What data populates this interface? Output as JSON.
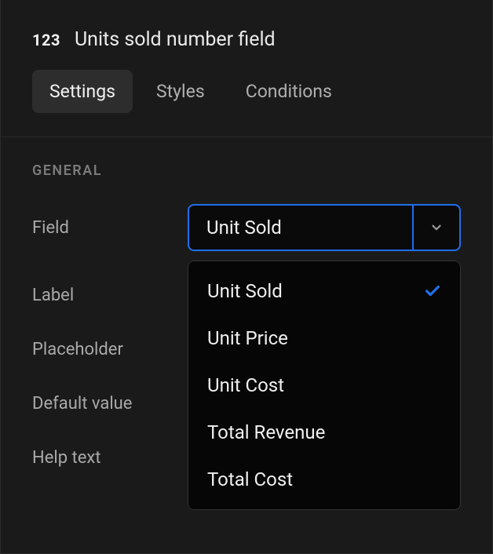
{
  "header": {
    "icon_label": "123",
    "title": "Units sold number field"
  },
  "tabs": {
    "settings": "Settings",
    "styles": "Styles",
    "conditions": "Conditions",
    "active": "settings"
  },
  "section": {
    "heading": "GENERAL",
    "rows": {
      "field": {
        "label": "Field",
        "value": "Unit Sold"
      },
      "label": {
        "label": "Label"
      },
      "placeholder": {
        "label": "Placeholder"
      },
      "default_value": {
        "label": "Default value"
      },
      "help_text": {
        "label": "Help text"
      }
    }
  },
  "dropdown": {
    "selected": "Unit Sold",
    "options": [
      "Unit Sold",
      "Unit Price",
      "Unit Cost",
      "Total Revenue",
      "Total Cost"
    ]
  },
  "colors": {
    "accent": "#1f6feb"
  }
}
